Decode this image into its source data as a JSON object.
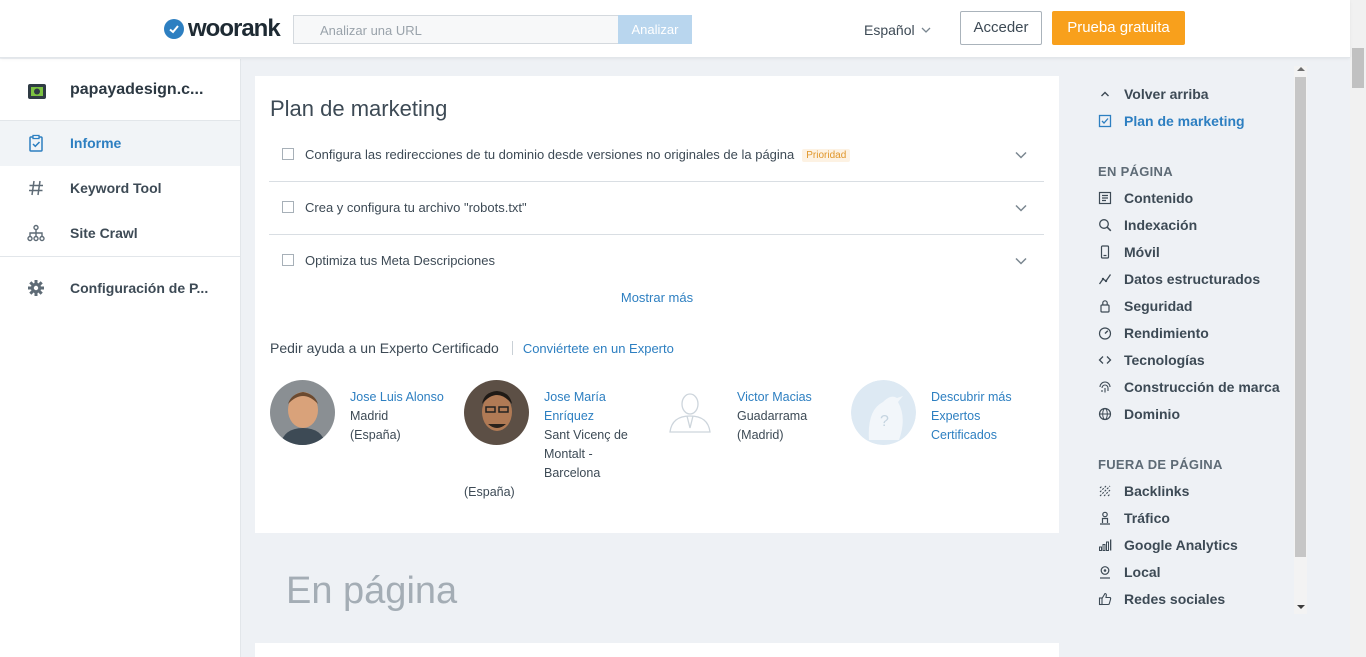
{
  "header": {
    "logo_text": "woorank",
    "url_placeholder": "Analizar una URL",
    "analyze_label": "Analizar",
    "language": "Español",
    "login_label": "Acceder",
    "trial_label": "Prueba gratuita"
  },
  "sidebar": {
    "site_name": "papayadesign.c...",
    "items": [
      {
        "label": "Informe",
        "icon": "clipboard-check-icon",
        "active": true
      },
      {
        "label": "Keyword Tool",
        "icon": "hash-icon"
      },
      {
        "label": "Site Crawl",
        "icon": "sitemap-icon"
      },
      {
        "label": "Configuración de P...",
        "icon": "gear-icon"
      }
    ]
  },
  "marketing_plan": {
    "title": "Plan de marketing",
    "tasks": [
      {
        "text": "Configura las redirecciones de tu dominio desde versiones no originales de la página",
        "badge": "Prioridad"
      },
      {
        "text": "Crea y configura tu archivo \"robots.txt\""
      },
      {
        "text": "Optimiza tus Meta Descripciones"
      }
    ],
    "show_more": "Mostrar más",
    "expert_help": "Pedir ayuda a un Experto Certificado",
    "become_expert": "Conviértete en un Experto",
    "experts": [
      {
        "name": "Jose Luis Alonso",
        "location_1": "Madrid",
        "location_2": "(España)"
      },
      {
        "name_1": "Jose María",
        "name_2": "Enríquez",
        "location_1": "Sant Vicenç de",
        "location_2": "Montalt -",
        "location_3": "Barcelona",
        "location_4": "(España)"
      },
      {
        "name": "Victor Macias",
        "location_1": "Guadarrama",
        "location_2": "(Madrid)"
      },
      {
        "line_1": "Descubrir más",
        "line_2": "Expertos",
        "line_3": "Certificados"
      }
    ]
  },
  "section_title": "En página",
  "right_nav": {
    "back_to_top": "Volver arriba",
    "marketing_plan": "Plan de marketing",
    "on_page_heading": "EN PÁGINA",
    "on_page": [
      "Contenido",
      "Indexación",
      "Móvil",
      "Datos estructurados",
      "Seguridad",
      "Rendimiento",
      "Tecnologías",
      "Construcción de marca",
      "Dominio"
    ],
    "off_page_heading": "FUERA DE PÁGINA",
    "off_page": [
      "Backlinks",
      "Tráfico",
      "Google Analytics",
      "Local",
      "Redes sociales"
    ]
  },
  "colors": {
    "accent": "#2d7fc1",
    "trial": "#f8a01c",
    "priority": "#e0962a",
    "background": "#eef1f5"
  }
}
